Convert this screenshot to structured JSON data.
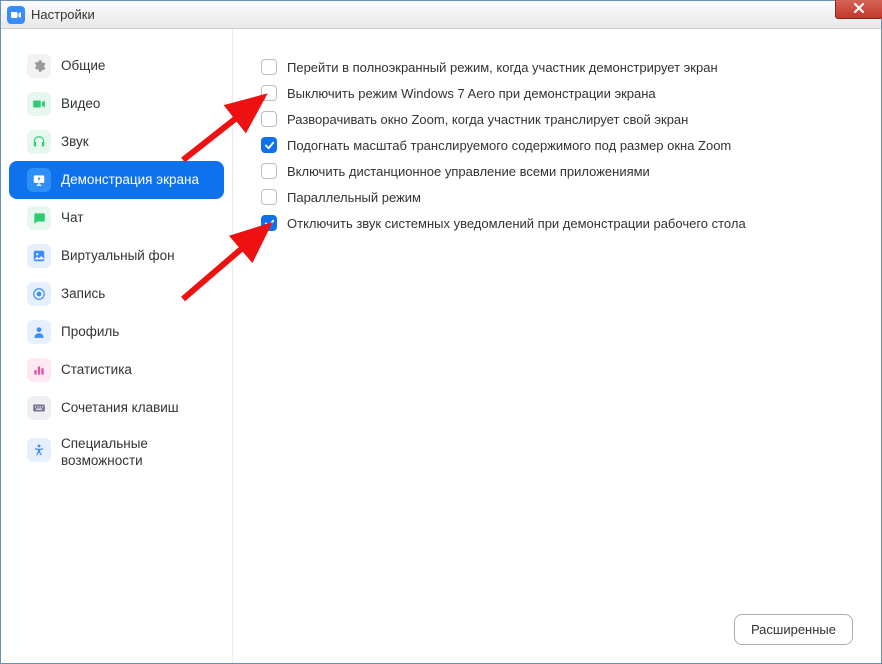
{
  "window": {
    "title": "Настройки"
  },
  "sidebar": {
    "items": [
      {
        "label": "Общие",
        "icon": "gear"
      },
      {
        "label": "Видео",
        "icon": "video"
      },
      {
        "label": "Звук",
        "icon": "headphones"
      },
      {
        "label": "Демонстрация экрана",
        "icon": "share-screen",
        "active": true
      },
      {
        "label": "Чат",
        "icon": "chat"
      },
      {
        "label": "Виртуальный фон",
        "icon": "virtual-bg"
      },
      {
        "label": "Запись",
        "icon": "record"
      },
      {
        "label": "Профиль",
        "icon": "profile"
      },
      {
        "label": "Статистика",
        "icon": "stats"
      },
      {
        "label": "Сочетания клавиш",
        "icon": "keyboard"
      },
      {
        "label": "Специальные возможности",
        "icon": "accessibility"
      }
    ]
  },
  "settings": {
    "options": [
      {
        "label": "Перейти в полноэкранный режим, когда участник демонстрирует экран",
        "checked": false
      },
      {
        "label": "Выключить режим Windows 7 Aero при демонстрации экрана",
        "checked": false
      },
      {
        "label": "Разворачивать окно Zoom, когда участник транслирует свой экран",
        "checked": false
      },
      {
        "label": "Подогнать масштаб транслируемого содержимого под размер окна Zoom",
        "checked": true
      },
      {
        "label": "Включить дистанционное управление всеми приложениями",
        "checked": false
      },
      {
        "label": "Параллельный режим",
        "checked": false
      },
      {
        "label": "Отключить звук системных уведомлений при демонстрации рабочего стола",
        "checked": true
      }
    ]
  },
  "footer": {
    "advanced_label": "Расширенные"
  },
  "colors": {
    "accent": "#0e72ed"
  }
}
